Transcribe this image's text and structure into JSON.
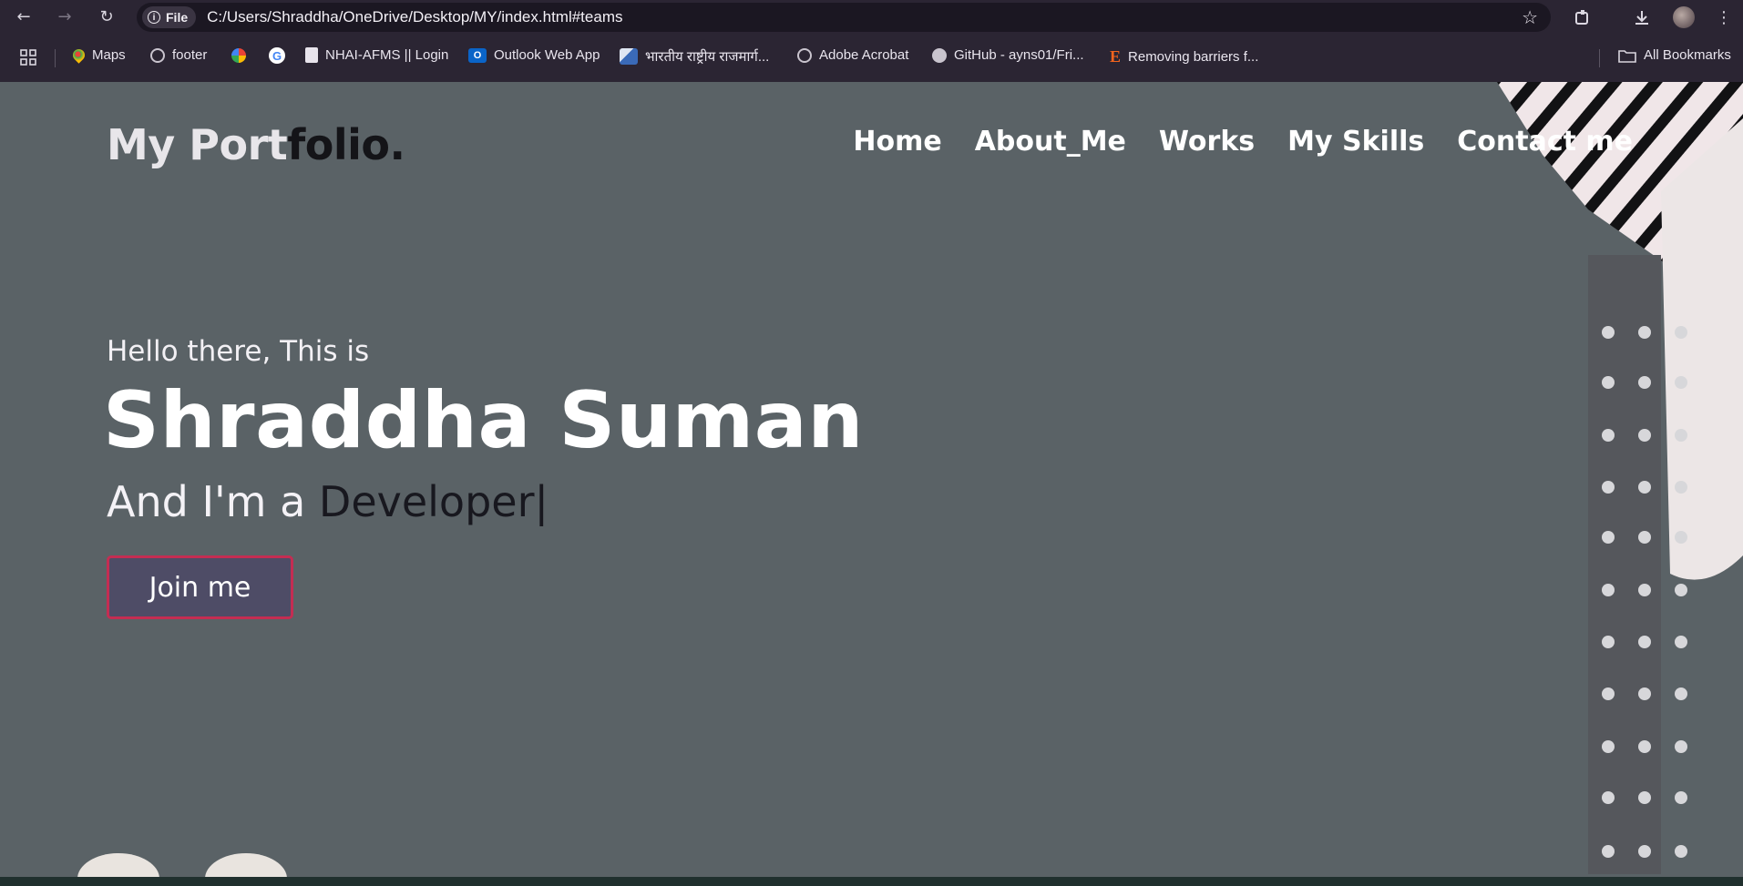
{
  "browser": {
    "file_chip": "File",
    "url": "C:/Users/Shraddha/OneDrive/Desktop/MY/index.html#teams"
  },
  "bookmarks": {
    "items": [
      {
        "label": "Maps",
        "icon": "maps-pin-icon",
        "color": "#34a853"
      },
      {
        "label": "footer",
        "icon": "globe-icon",
        "color": "#c9c4ce"
      },
      {
        "label": "",
        "icon": "pinwheel-icon",
        "color": "#fbbc05"
      },
      {
        "label": "",
        "icon": "google-icon",
        "color": "#4285f4"
      },
      {
        "label": "NHAI-AFMS || Login",
        "icon": "document-icon",
        "color": "#e8e4ec"
      },
      {
        "label": "Outlook Web App",
        "icon": "outlook-icon",
        "color": "#0a64c8"
      },
      {
        "label": "भारतीय राष्ट्रीय राजमार्ग...",
        "icon": "nhai-logo-icon",
        "color": "#5a8ed0"
      },
      {
        "label": "Adobe Acrobat",
        "icon": "globe-icon",
        "color": "#c9c4ce"
      },
      {
        "label": "GitHub - ayns01/Fri...",
        "icon": "github-icon",
        "color": "#c9c4ce"
      },
      {
        "label": "Removing barriers f...",
        "icon": "etsy-icon",
        "color": "#f1641e"
      }
    ],
    "all_bookmarks": "All Bookmarks"
  },
  "site": {
    "logo_light": "My Port",
    "logo_dark": "folio.",
    "nav": [
      "Home",
      "About_Me",
      "Works",
      "My Skills",
      "Contact me"
    ],
    "hello": "Hello there, This is",
    "name": "Shraddha Suman",
    "role_prefix": "And I'm a ",
    "role_typed": "Developer",
    "cursor": "|",
    "cta": "Join me"
  },
  "colors": {
    "page_bg": "#5a6266",
    "browser_bg": "#2b2533",
    "button_bg": "#4e4c66",
    "button_border": "#c42d52"
  }
}
